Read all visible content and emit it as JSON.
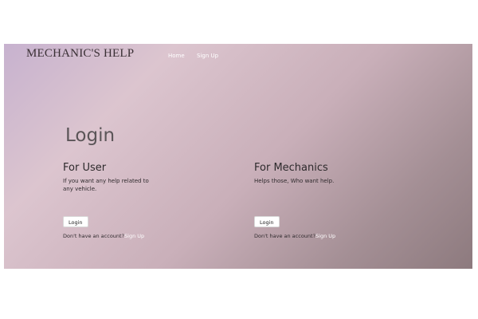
{
  "header": {
    "brand": "MECHANIC'S HELP",
    "nav": {
      "home": "Home",
      "signup": "Sign Up"
    }
  },
  "main": {
    "title": "Login",
    "user": {
      "heading": "For User",
      "description": "If you want any help related to any vehicle.",
      "login_label": "Login",
      "account_prompt": "Don't have an account?",
      "signup_link": "Sign Up"
    },
    "mechanic": {
      "heading": "For Mechanics",
      "description": "Helps those, Who want help.",
      "login_label": "Login",
      "account_prompt": "Don't have an account?",
      "signup_link": "Sign Up"
    }
  },
  "colors": {
    "gradient_start": "#c7b2cf",
    "gradient_end": "#8d7a7e",
    "link": "#ffffff"
  }
}
